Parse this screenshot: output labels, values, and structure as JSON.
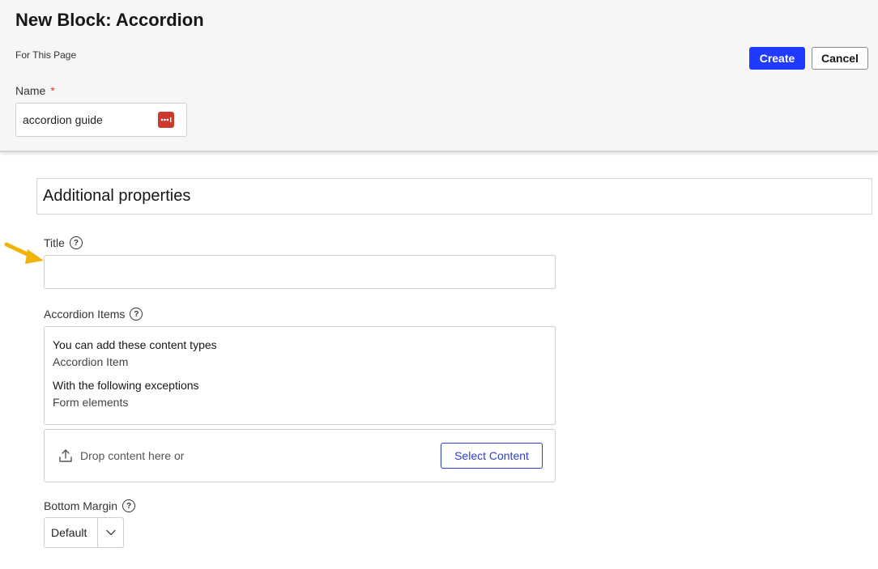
{
  "header": {
    "title": "New Block: Accordion",
    "subtitle": "For This Page",
    "name_label": "Name",
    "required_mark": "*",
    "name_value": "accordion guide",
    "create_label": "Create",
    "cancel_label": "Cancel"
  },
  "section": {
    "title": "Additional properties"
  },
  "fields": {
    "title_label": "Title",
    "title_value": "",
    "accordion_label": "Accordion Items",
    "allowed_heading": "You can add these content types",
    "allowed_type": "Accordion Item",
    "exceptions_heading": "With the following exceptions",
    "exceptions_type": "Form elements",
    "drop_text": "Drop content here or",
    "select_content_label": "Select Content",
    "bottom_margin_label": "Bottom Margin",
    "bottom_margin_value": "Default"
  },
  "icons": {
    "help": "question-circle-icon",
    "password_manager": "password-manager-icon",
    "upload": "upload-icon",
    "chevron": "chevron-down-icon",
    "arrow": "pointer-arrow-icon"
  },
  "colors": {
    "primary": "#1f3bff",
    "required": "#e0362c",
    "arrow": "#f2b20c",
    "password_icon": "#cc3a2e"
  }
}
